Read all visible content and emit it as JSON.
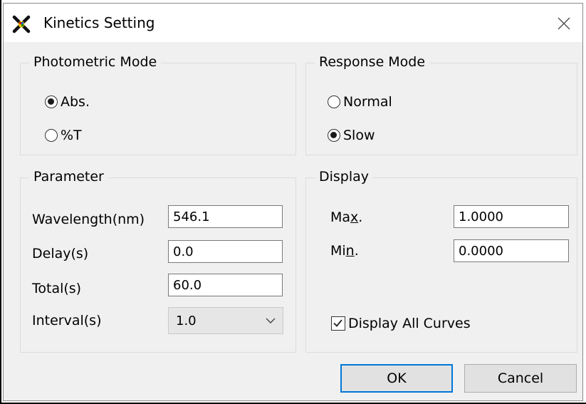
{
  "window": {
    "title": "Kinetics Setting",
    "app_icon": "kinetics-app-icon",
    "close_icon": "close-icon"
  },
  "photometric_mode": {
    "label": "Photometric Mode",
    "options": [
      {
        "label": "Abs.",
        "checked": true
      },
      {
        "label": "%T",
        "checked": false
      }
    ]
  },
  "response_mode": {
    "label": "Response Mode",
    "options": [
      {
        "label": "Normal",
        "checked": false
      },
      {
        "label": "Slow",
        "checked": true
      }
    ]
  },
  "parameter": {
    "label": "Parameter",
    "wavelength_label": "Wavelength(nm)",
    "wavelength_value": "546.1",
    "delay_label": "Delay(s)",
    "delay_value": "0.0",
    "total_label": "Total(s)",
    "total_value": "60.0",
    "interval_label": "Interval(s)",
    "interval_value": "1.0",
    "interval_icon": "chevron-down-icon"
  },
  "display": {
    "label": "Display",
    "max_label_pre": "Ma",
    "max_label_ul": "x",
    "max_label_post": ".",
    "max_value": "1.0000",
    "min_label_pre": "Mi",
    "min_label_ul": "n",
    "min_label_post": ".",
    "min_value": "0.0000",
    "all_curves_label": "Display All Curves",
    "all_curves_checked": true
  },
  "buttons": {
    "ok_label": "OK",
    "cancel_label": "Cancel"
  },
  "colors": {
    "dialog_bg": "#f0f0f0",
    "titlebar_bg": "#ffffff",
    "default_button_border": "#0078d7"
  }
}
